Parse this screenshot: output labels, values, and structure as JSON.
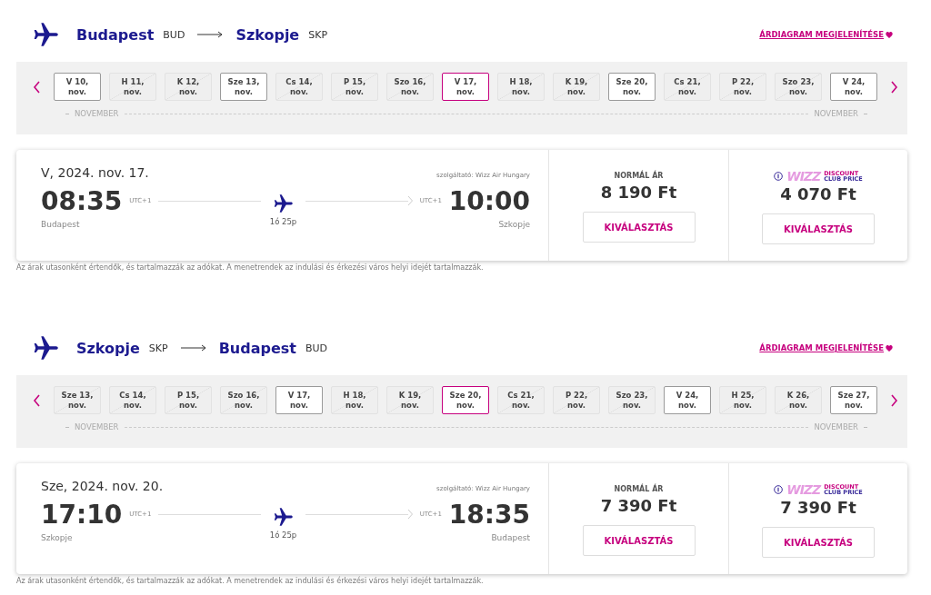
{
  "sections": [
    {
      "origin": {
        "city": "Budapest",
        "code": "BUD"
      },
      "destination": {
        "city": "Szkopje",
        "code": "SKP"
      },
      "price_chart_link": "ÁRDIAGRAM MEGJELENÍTÉSE",
      "days": [
        {
          "day": "V 10,",
          "month": "nov.",
          "available": true,
          "selected": false
        },
        {
          "day": "H 11,",
          "month": "nov.",
          "available": false,
          "selected": false
        },
        {
          "day": "K 12,",
          "month": "nov.",
          "available": false,
          "selected": false
        },
        {
          "day": "Sze 13,",
          "month": "nov.",
          "available": true,
          "selected": false
        },
        {
          "day": "Cs 14,",
          "month": "nov.",
          "available": false,
          "selected": false
        },
        {
          "day": "P 15,",
          "month": "nov.",
          "available": false,
          "selected": false
        },
        {
          "day": "Szo 16,",
          "month": "nov.",
          "available": false,
          "selected": false
        },
        {
          "day": "V 17,",
          "month": "nov.",
          "available": true,
          "selected": true
        },
        {
          "day": "H 18,",
          "month": "nov.",
          "available": false,
          "selected": false
        },
        {
          "day": "K 19,",
          "month": "nov.",
          "available": false,
          "selected": false
        },
        {
          "day": "Sze 20,",
          "month": "nov.",
          "available": true,
          "selected": false
        },
        {
          "day": "Cs 21,",
          "month": "nov.",
          "available": false,
          "selected": false
        },
        {
          "day": "P 22,",
          "month": "nov.",
          "available": false,
          "selected": false
        },
        {
          "day": "Szo 23,",
          "month": "nov.",
          "available": false,
          "selected": false
        },
        {
          "day": "V 24,",
          "month": "nov.",
          "available": true,
          "selected": false
        }
      ],
      "month_labels": [
        "NOVEMBER",
        "NOVEMBER"
      ],
      "flight": {
        "date": "V, 2024. nov. 17.",
        "operator": "szolgáltató: Wizz Air Hungary",
        "departure": {
          "time": "08:35",
          "tz": "UTC+1",
          "city": "Budapest"
        },
        "arrival": {
          "time": "10:00",
          "tz": "UTC+1",
          "city": "Szkopje"
        },
        "duration": "1ó 25p"
      },
      "fares": [
        {
          "kind": "normal",
          "label": "NORMÁL ÁR",
          "price": "8 190 Ft",
          "button": "KIVÁLASZTÁS"
        },
        {
          "kind": "club",
          "brand": "WIZZ",
          "brand_line1": "DISCOUNT",
          "brand_line2": "CLUB PRICE",
          "price": "4 070 Ft",
          "button": "KIVÁLASZTÁS"
        }
      ],
      "note": "Az árak utasonként értendők, és tartalmazzák az adókat. A menetrendek az indulási és érkezési város helyi idejét tartalmazzák."
    },
    {
      "origin": {
        "city": "Szkopje",
        "code": "SKP"
      },
      "destination": {
        "city": "Budapest",
        "code": "BUD"
      },
      "price_chart_link": "ÁRDIAGRAM MEGJELENÍTÉSE",
      "days": [
        {
          "day": "Sze 13,",
          "month": "nov.",
          "available": false,
          "selected": false
        },
        {
          "day": "Cs 14,",
          "month": "nov.",
          "available": false,
          "selected": false
        },
        {
          "day": "P 15,",
          "month": "nov.",
          "available": false,
          "selected": false
        },
        {
          "day": "Szo 16,",
          "month": "nov.",
          "available": false,
          "selected": false
        },
        {
          "day": "V 17,",
          "month": "nov.",
          "available": true,
          "selected": false
        },
        {
          "day": "H 18,",
          "month": "nov.",
          "available": false,
          "selected": false
        },
        {
          "day": "K 19,",
          "month": "nov.",
          "available": false,
          "selected": false
        },
        {
          "day": "Sze 20,",
          "month": "nov.",
          "available": true,
          "selected": true
        },
        {
          "day": "Cs 21,",
          "month": "nov.",
          "available": false,
          "selected": false
        },
        {
          "day": "P 22,",
          "month": "nov.",
          "available": false,
          "selected": false
        },
        {
          "day": "Szo 23,",
          "month": "nov.",
          "available": false,
          "selected": false
        },
        {
          "day": "V 24,",
          "month": "nov.",
          "available": true,
          "selected": false
        },
        {
          "day": "H 25,",
          "month": "nov.",
          "available": false,
          "selected": false
        },
        {
          "day": "K 26,",
          "month": "nov.",
          "available": false,
          "selected": false
        },
        {
          "day": "Sze 27,",
          "month": "nov.",
          "available": true,
          "selected": false
        }
      ],
      "month_labels": [
        "NOVEMBER",
        "NOVEMBER"
      ],
      "flight": {
        "date": "Sze, 2024. nov. 20.",
        "operator": "szolgáltató: Wizz Air Hungary",
        "departure": {
          "time": "17:10",
          "tz": "UTC+1",
          "city": "Szkopje"
        },
        "arrival": {
          "time": "18:35",
          "tz": "UTC+1",
          "city": "Budapest"
        },
        "duration": "1ó 25p"
      },
      "fares": [
        {
          "kind": "normal",
          "label": "NORMÁL ÁR",
          "price": "7 390 Ft",
          "button": "KIVÁLASZTÁS"
        },
        {
          "kind": "club",
          "brand": "WIZZ",
          "brand_line1": "DISCOUNT",
          "brand_line2": "CLUB PRICE",
          "price": "7 390 Ft",
          "button": "KIVÁLASZTÁS"
        }
      ],
      "note": "Az árak utasonként értendők, és tartalmazzák az adókat. A menetrendek az indulási és érkezési város helyi idejét tartalmazzák."
    }
  ]
}
